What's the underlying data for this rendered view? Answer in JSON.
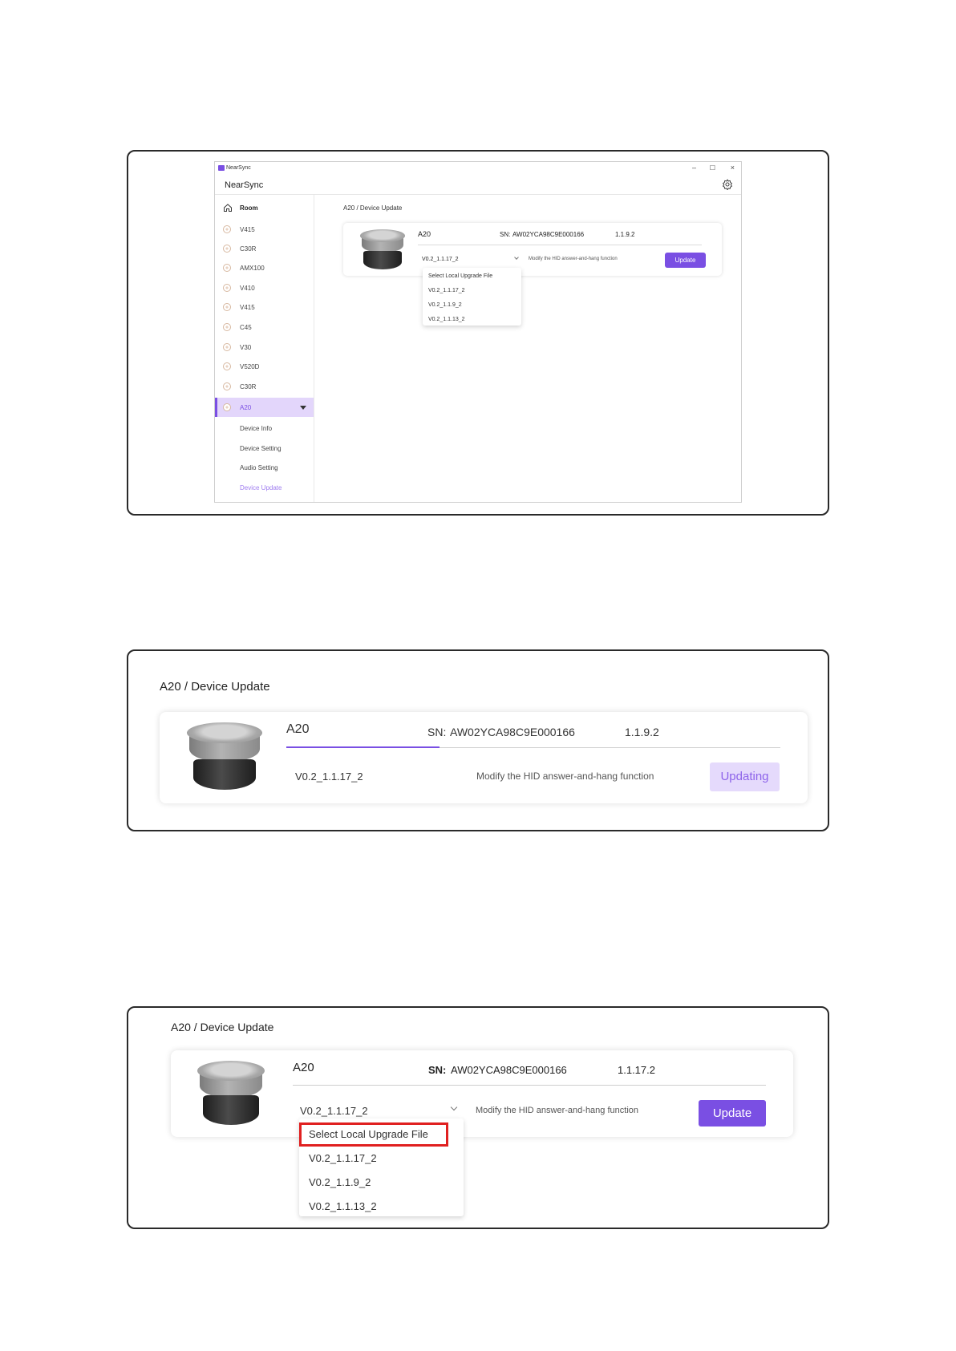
{
  "app": {
    "window_title": "NearSync",
    "app_name": "NearSync",
    "window_controls": {
      "minimize": "–",
      "maximize": "☐",
      "close": "×"
    }
  },
  "sidebar": {
    "room_label": "Room",
    "devices": [
      "V415",
      "C30R",
      "AMX100",
      "V410",
      "V415",
      "C45",
      "V30",
      "V520D",
      "C30R",
      "A20"
    ],
    "active_device": "A20",
    "submenu": [
      "Device Info",
      "Device Setting",
      "Audio Setting",
      "Device Update"
    ],
    "active_submenu": "Device Update"
  },
  "panel1": {
    "breadcrumb": "A20 / Device Update",
    "device_name": "A20",
    "sn_label": "SN:",
    "sn_value": "AW02YCA98C9E000166",
    "version": "1.1.9.2",
    "selected_file": "V0.2_1.1.17_2",
    "description": "Modify the HID answer-and-hang function",
    "button_label": "Update",
    "dropdown_options": [
      "Select Local Upgrade File",
      "V0.2_1.1.17_2",
      "V0.2_1.1.9_2",
      "V0.2_1.1.13_2"
    ]
  },
  "panel2": {
    "breadcrumb": "A20 / Device Update",
    "device_name": "A20",
    "sn_label": "SN:",
    "sn_value": "AW02YCA98C9E000166",
    "version": "1.1.9.2",
    "selected_file": "V0.2_1.1.17_2",
    "description": "Modify the HID answer-and-hang function",
    "button_label": "Updating"
  },
  "panel3": {
    "breadcrumb": "A20 / Device Update",
    "device_name": "A20",
    "sn_label": "SN:",
    "sn_value": "AW02YCA98C9E000166",
    "version": "1.1.17.2",
    "selected_file": "V0.2_1.1.17_2",
    "description": "Modify the HID answer-and-hang function",
    "button_label": "Update",
    "dropdown_options": [
      "Select Local Upgrade File",
      "V0.2_1.1.17_2",
      "V0.2_1.1.9_2",
      "V0.2_1.1.13_2"
    ],
    "highlighted_option": "Select Local Upgrade File"
  },
  "colors": {
    "accent": "#7a4fe3",
    "accent_light": "#e5dafc",
    "highlight": "#e02020"
  }
}
